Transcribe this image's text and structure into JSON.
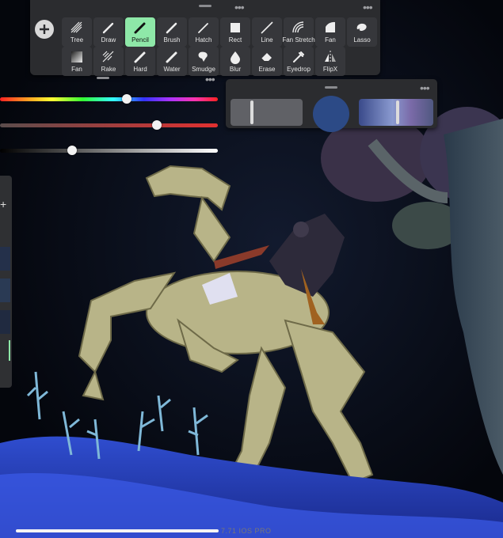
{
  "toolbar": {
    "tools_row1": [
      {
        "label": "Tree",
        "icon": "tree-brush-icon"
      },
      {
        "label": "Draw",
        "icon": "draw-brush-icon"
      },
      {
        "label": "Pencil",
        "icon": "pencil-brush-icon",
        "active": true
      },
      {
        "label": "Brush",
        "icon": "brush-icon"
      },
      {
        "label": "Hatch",
        "icon": "hatch-brush-icon"
      },
      {
        "label": "Rect",
        "icon": "rect-brush-icon"
      },
      {
        "label": "Line",
        "icon": "line-brush-icon"
      },
      {
        "label": "Fan Stretch",
        "icon": "fan-stretch-brush-icon"
      },
      {
        "label": "Fan",
        "icon": "fan-brush-icon"
      },
      {
        "label": "Lasso",
        "icon": "lasso-brush-icon"
      }
    ],
    "tools_row2": [
      {
        "label": "Fan",
        "icon": "fan-gradient-icon"
      },
      {
        "label": "Rake",
        "icon": "rake-brush-icon"
      },
      {
        "label": "Hard",
        "icon": "hard-brush-icon"
      },
      {
        "label": "Water",
        "icon": "water-brush-icon"
      },
      {
        "label": "Smudge",
        "icon": "smudge-icon"
      },
      {
        "label": "Blur",
        "icon": "blur-icon"
      },
      {
        "label": "Erase",
        "icon": "eraser-icon"
      },
      {
        "label": "Eyedrop",
        "icon": "eyedropper-icon"
      },
      {
        "label": "FlipX",
        "icon": "flip-x-icon"
      }
    ]
  },
  "sliders": {
    "hue": 0.58,
    "saturation": 0.72,
    "value": 0.33
  },
  "preview": {
    "current_color": "#2c4a86",
    "left_slider": 0.3,
    "right_slider": 0.52
  },
  "colors": {
    "accent": "#8ee8a8",
    "panel": "#2b2c2f"
  },
  "footer": {
    "version": "7.71 IOS PRO"
  }
}
